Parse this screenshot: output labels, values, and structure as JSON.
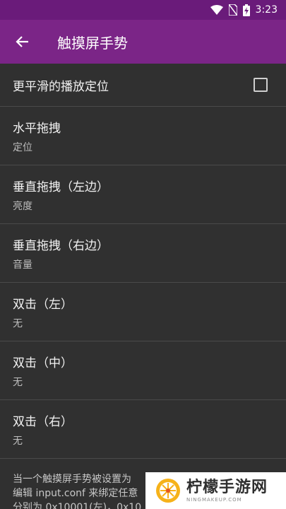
{
  "status_bar": {
    "time": "3:23"
  },
  "app_bar": {
    "title": "触摸屏手势"
  },
  "settings": [
    {
      "title": "更平滑的播放定位",
      "subtitle": null,
      "checked": false
    },
    {
      "title": "水平拖拽",
      "subtitle": "定位"
    },
    {
      "title": "垂直拖拽（左边）",
      "subtitle": "亮度"
    },
    {
      "title": "垂直拖拽（右边）",
      "subtitle": "音量"
    },
    {
      "title": "双击（左）",
      "subtitle": "无"
    },
    {
      "title": "双击（中）",
      "subtitle": "无"
    },
    {
      "title": "双击（右）",
      "subtitle": "无"
    }
  ],
  "footer": {
    "line1": "当一个触摸屏手势被设置为",
    "line2": "编辑 input.conf 来绑定任意",
    "line3": "分别为 0x10001(左)，0x10"
  },
  "watermark": {
    "brand": "柠檬手游网",
    "domain": "NINGMAKEUP.COM"
  },
  "colors": {
    "app_bar": "#7b2587",
    "status_bar": "#6a1b7a",
    "background": "#303030"
  }
}
